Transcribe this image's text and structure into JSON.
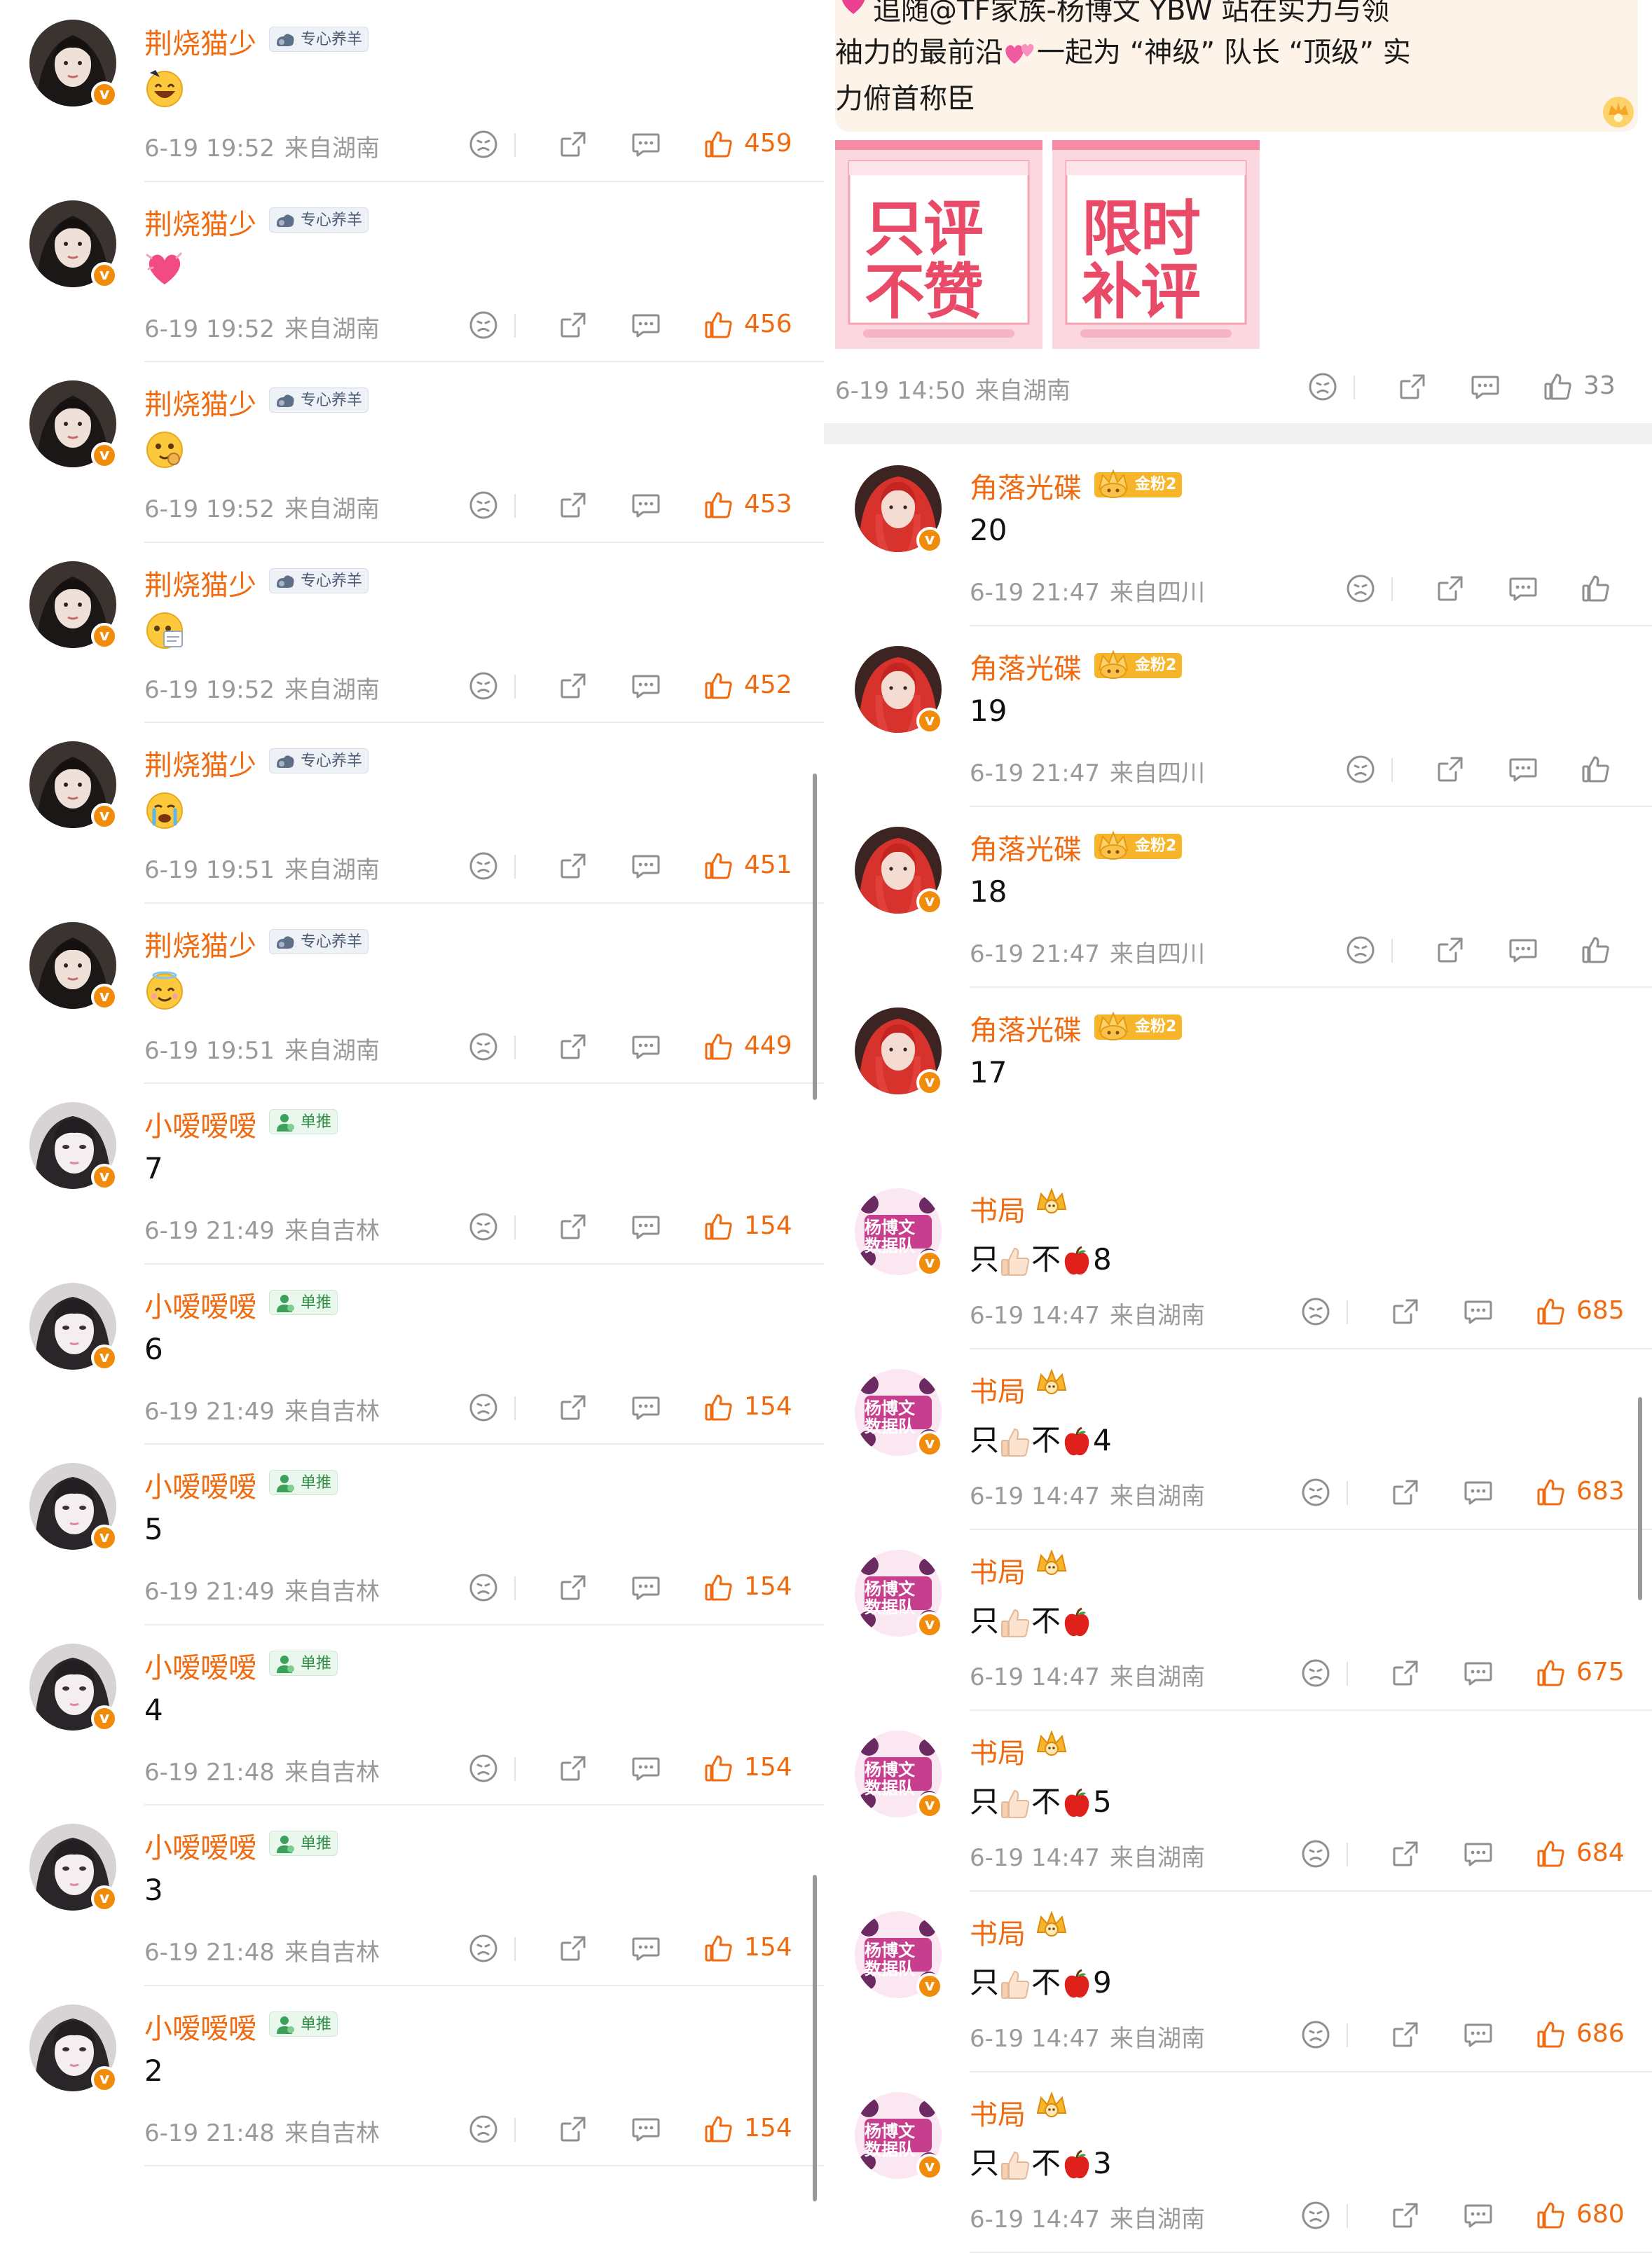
{
  "left": {
    "rows": [
      {
        "user": "荆烧猫少",
        "tag": "专心养羊",
        "tag_style": "gray",
        "avatar": "dark-hair",
        "emoji": "laughing-emoji",
        "time": "6-19 19:52",
        "loc": "来自湖南",
        "likes": "459"
      },
      {
        "user": "荆烧猫少",
        "tag": "专心养羊",
        "tag_style": "gray",
        "avatar": "dark-hair",
        "emoji": "heart-emoji",
        "time": "6-19 19:52",
        "loc": "来自湖南",
        "likes": "456"
      },
      {
        "user": "荆烧猫少",
        "tag": "专心养羊",
        "tag_style": "gray",
        "avatar": "dark-hair",
        "emoji": "love-face-emoji",
        "time": "6-19 19:52",
        "loc": "来自湖南",
        "likes": "453"
      },
      {
        "user": "荆烧猫少",
        "tag": "专心养羊",
        "tag_style": "gray",
        "avatar": "dark-hair",
        "emoji": "note-face-emoji",
        "time": "6-19 19:52",
        "loc": "来自湖南",
        "likes": "452"
      },
      {
        "user": "荆烧猫少",
        "tag": "专心养羊",
        "tag_style": "gray",
        "avatar": "dark-hair",
        "emoji": "crying-emoji",
        "time": "6-19 19:51",
        "loc": "来自湖南",
        "likes": "451"
      },
      {
        "user": "荆烧猫少",
        "tag": "专心养羊",
        "tag_style": "gray",
        "avatar": "dark-hair",
        "emoji": "halo-smile-emoji",
        "time": "6-19 19:51",
        "loc": "来自湖南",
        "likes": "449"
      },
      {
        "user": "小嗳嗳嗳",
        "tag": "单推",
        "tag_style": "green",
        "avatar": "pale-face",
        "text": "7",
        "time": "6-19 21:49",
        "loc": "来自吉林",
        "likes": "154"
      },
      {
        "user": "小嗳嗳嗳",
        "tag": "单推",
        "tag_style": "green",
        "avatar": "pale-face",
        "text": "6",
        "time": "6-19 21:49",
        "loc": "来自吉林",
        "likes": "154"
      },
      {
        "user": "小嗳嗳嗳",
        "tag": "单推",
        "tag_style": "green",
        "avatar": "pale-face",
        "text": "5",
        "time": "6-19 21:49",
        "loc": "来自吉林",
        "likes": "154"
      },
      {
        "user": "小嗳嗳嗳",
        "tag": "单推",
        "tag_style": "green",
        "avatar": "pale-face",
        "text": "4",
        "time": "6-19 21:48",
        "loc": "来自吉林",
        "likes": "154"
      },
      {
        "user": "小嗳嗳嗳",
        "tag": "单推",
        "tag_style": "green",
        "avatar": "pale-face",
        "text": "3",
        "time": "6-19 21:48",
        "loc": "来自吉林",
        "likes": "154"
      },
      {
        "user": "小嗳嗳嗳",
        "tag": "单推",
        "tag_style": "green",
        "avatar": "pale-face",
        "text": "2",
        "time": "6-19 21:48",
        "loc": "来自吉林",
        "likes": "154"
      }
    ]
  },
  "right": {
    "post": {
      "line1": "追随@TF家族-杨博文 YBW 站在实力与领",
      "line2": "袖力的最前沿",
      "line2b": "一起为 “神级” 队长 “顶级” 实",
      "line3": "力俯首称臣",
      "sticker1": [
        "只评",
        "不赞"
      ],
      "sticker2": [
        "限时",
        "补评"
      ],
      "time": "6-19 14:50",
      "loc": "来自湖南",
      "likes": "33"
    },
    "rows": [
      {
        "user": "角落光碟",
        "tag": "金粉2",
        "tag_style": "gold",
        "avatar": "red-hair",
        "text": "20",
        "time": "6-19 21:47",
        "loc": "来自四川",
        "likes": ""
      },
      {
        "user": "角落光碟",
        "tag": "金粉2",
        "tag_style": "gold",
        "avatar": "red-hair",
        "text": "19",
        "time": "6-19 21:47",
        "loc": "来自四川",
        "likes": ""
      },
      {
        "user": "角落光碟",
        "tag": "金粉2",
        "tag_style": "gold",
        "avatar": "red-hair",
        "text": "18",
        "time": "6-19 21:47",
        "loc": "来自四川",
        "likes": ""
      },
      {
        "user": "角落光碟",
        "tag": "金粉2",
        "tag_style": "gold",
        "avatar": "red-hair",
        "text": "17",
        "time": "",
        "loc": "",
        "likes": ""
      },
      {
        "user": "书局",
        "tag": "",
        "tag_style": "crown",
        "avatar": "data-team",
        "prefix": "只",
        "mid": "不",
        "text": "8",
        "time": "6-19 14:47",
        "loc": "来自湖南",
        "likes": "685"
      },
      {
        "user": "书局",
        "tag": "",
        "tag_style": "crown",
        "avatar": "data-team",
        "prefix": "只",
        "mid": "不",
        "text": "4",
        "time": "6-19 14:47",
        "loc": "来自湖南",
        "likes": "683"
      },
      {
        "user": "书局",
        "tag": "",
        "tag_style": "crown",
        "avatar": "data-team",
        "prefix": "只",
        "mid": "不",
        "text": "",
        "time": "6-19 14:47",
        "loc": "来自湖南",
        "likes": "675"
      },
      {
        "user": "书局",
        "tag": "",
        "tag_style": "crown",
        "avatar": "data-team",
        "prefix": "只",
        "mid": "不",
        "text": "5",
        "time": "6-19 14:47",
        "loc": "来自湖南",
        "likes": "684"
      },
      {
        "user": "书局",
        "tag": "",
        "tag_style": "crown",
        "avatar": "data-team",
        "prefix": "只",
        "mid": "不",
        "text": "9",
        "time": "6-19 14:47",
        "loc": "来自湖南",
        "likes": "686"
      },
      {
        "user": "书局",
        "tag": "",
        "tag_style": "crown",
        "avatar": "data-team",
        "prefix": "只",
        "mid": "不",
        "text": "3",
        "time": "6-19 14:47",
        "loc": "来自湖南",
        "likes": "680"
      }
    ],
    "avatar_text": [
      "杨博文",
      "数据队"
    ]
  },
  "icons": {
    "dislike": "dislike-face-icon",
    "share": "share-icon",
    "comment": "comment-icon",
    "like": "thumbs-up-icon",
    "verified": "verified-v-icon"
  },
  "colors": {
    "accent": "#f06a0f",
    "meta": "#9a9a9a",
    "divider": "#ededed",
    "gold": "#f7b52b"
  }
}
